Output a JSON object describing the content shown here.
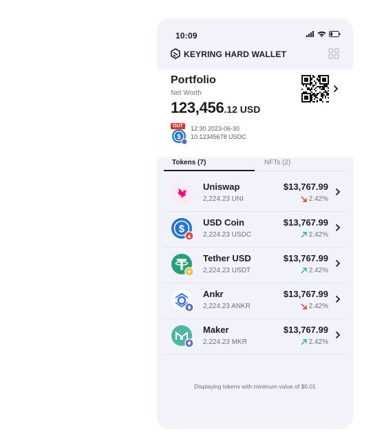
{
  "status": {
    "time": "10:09"
  },
  "app": {
    "brand": "KEYRING HARD WALLET"
  },
  "portfolio": {
    "title": "Portfolio",
    "net_worth_label": "Net Worth",
    "net_worth_int": "123,456",
    "net_worth_dec": ".12 USD",
    "last_tx": {
      "badge": "OUT",
      "time": "12:30 2023-06-30",
      "amount": "10.12345678 USDC"
    }
  },
  "tabs": [
    {
      "label": "Tokens (7)",
      "active": true
    },
    {
      "label": "NFTs (2)",
      "active": false
    }
  ],
  "tokens": [
    {
      "name": "Uniswap",
      "amount": "2,224.23 UNI",
      "value": "$13,767.99",
      "change": "2.42%",
      "direction": "down"
    },
    {
      "name": "USD Coin",
      "amount": "2,224.23 USDC",
      "value": "$13,767.99",
      "change": "2.42%",
      "direction": "up"
    },
    {
      "name": "Tether USD",
      "amount": "2,224.23 USDT",
      "value": "$13,767.99",
      "change": "2.42%",
      "direction": "up"
    },
    {
      "name": "Ankr",
      "amount": "2,224.23 ANKR",
      "value": "$13,767.99",
      "change": "2.42%",
      "direction": "down"
    },
    {
      "name": "Maker",
      "amount": "2,224.23 MKR",
      "value": "$13,767.99",
      "change": "2.42%",
      "direction": "up"
    }
  ],
  "footer": {
    "note": "Displaying tokens with minimum value of $0.01"
  },
  "colors": {
    "up": "#1db59a",
    "down": "#e0341f",
    "usdc": "#2775ca",
    "tether": "#26a17b",
    "maker": "#4fb7a1",
    "uniswap": "#ff007a"
  }
}
